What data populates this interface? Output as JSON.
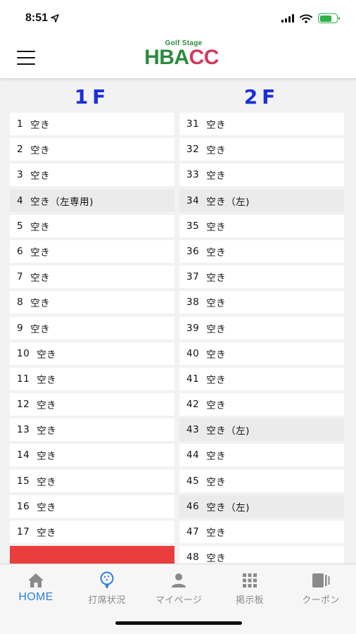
{
  "status": {
    "time": "8:51"
  },
  "header": {
    "logo_sub": "Golf Stage",
    "logo_main_green": "HBA",
    "logo_main_pink": "CC"
  },
  "floors": {
    "left_label": "1F",
    "right_label": "2F",
    "left": [
      {
        "num": "1",
        "status": "空き"
      },
      {
        "num": "2",
        "status": "空き"
      },
      {
        "num": "3",
        "status": "空き"
      },
      {
        "num": "4",
        "status": "空き（左専用)"
      },
      {
        "num": "5",
        "status": "空き"
      },
      {
        "num": "6",
        "status": "空き"
      },
      {
        "num": "7",
        "status": "空き"
      },
      {
        "num": "8",
        "status": "空き"
      },
      {
        "num": "9",
        "status": "空き"
      },
      {
        "num": "10",
        "status": "空き"
      },
      {
        "num": "11",
        "status": "空き"
      },
      {
        "num": "12",
        "status": "空き"
      },
      {
        "num": "13",
        "status": "空き"
      },
      {
        "num": "14",
        "status": "空き"
      },
      {
        "num": "15",
        "status": "空き"
      },
      {
        "num": "16",
        "status": "空き"
      },
      {
        "num": "17",
        "status": "空き"
      },
      {
        "num": "",
        "status": ""
      }
    ],
    "right": [
      {
        "num": "31",
        "status": "空き"
      },
      {
        "num": "32",
        "status": "空き"
      },
      {
        "num": "33",
        "status": "空き"
      },
      {
        "num": "34",
        "status": "空き（左)"
      },
      {
        "num": "35",
        "status": "空き"
      },
      {
        "num": "36",
        "status": "空き"
      },
      {
        "num": "37",
        "status": "空き"
      },
      {
        "num": "38",
        "status": "空き"
      },
      {
        "num": "39",
        "status": "空き"
      },
      {
        "num": "40",
        "status": "空き"
      },
      {
        "num": "41",
        "status": "空き"
      },
      {
        "num": "42",
        "status": "空き"
      },
      {
        "num": "43",
        "status": "空き（左)"
      },
      {
        "num": "44",
        "status": "空き"
      },
      {
        "num": "45",
        "status": "空き"
      },
      {
        "num": "46",
        "status": "空き（左)"
      },
      {
        "num": "47",
        "status": "空き"
      },
      {
        "num": "48",
        "status": "空き"
      }
    ]
  },
  "tabs": [
    {
      "label": "HOME",
      "icon": "home-icon"
    },
    {
      "label": "打席状況",
      "icon": "golf-ball-icon"
    },
    {
      "label": "マイページ",
      "icon": "person-icon"
    },
    {
      "label": "掲示板",
      "icon": "grid-icon"
    },
    {
      "label": "クーポン",
      "icon": "coupon-icon"
    }
  ],
  "colors": {
    "accent_blue": "#2d7fe0",
    "floor_label": "#1b2fd6",
    "busy_red": "#ea3d3d",
    "left_only_gray": "#ebebeb"
  }
}
